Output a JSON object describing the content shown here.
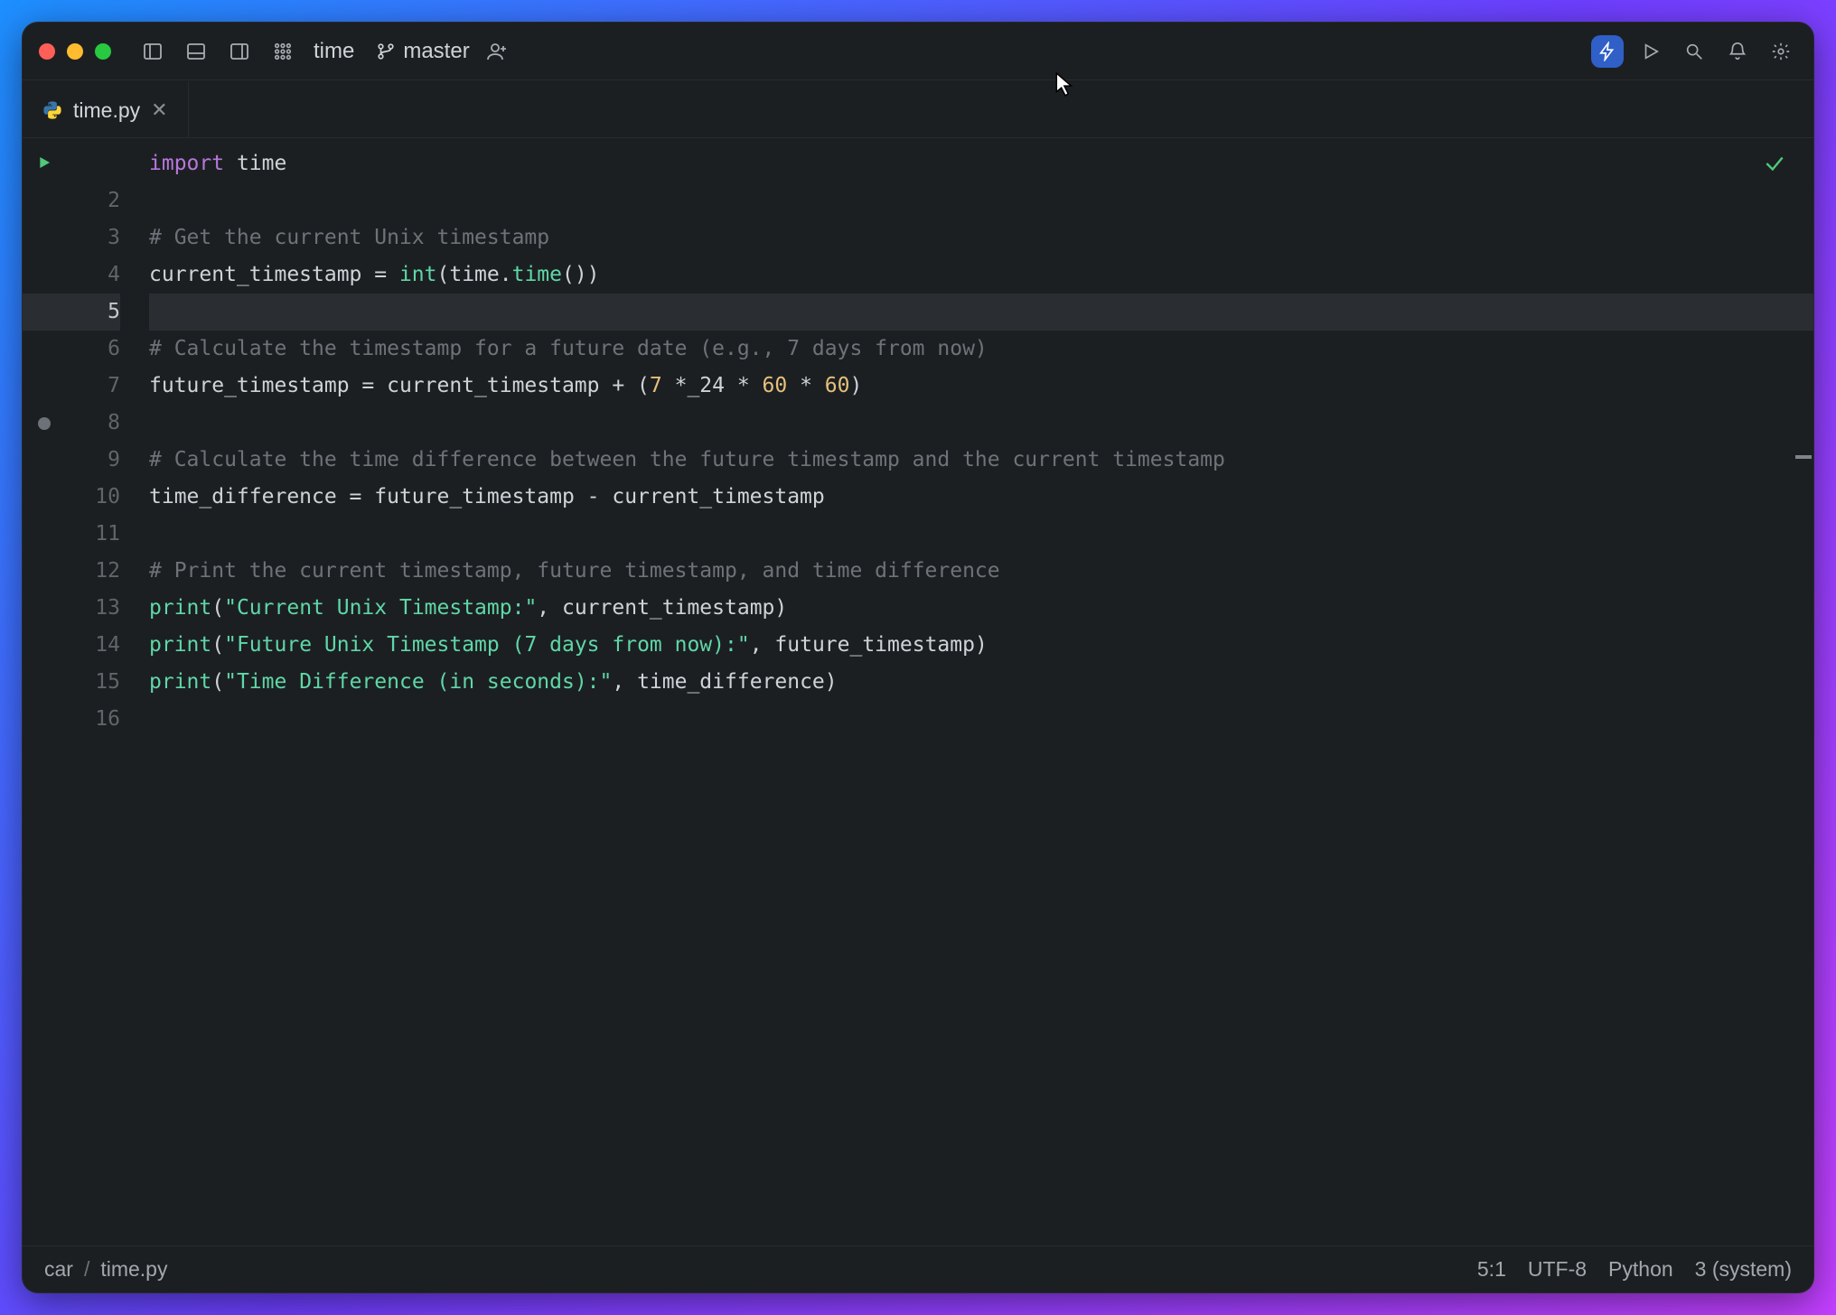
{
  "titlebar": {
    "project_name": "time",
    "branch_label": "master"
  },
  "tabs": {
    "active": {
      "filename": "time.py"
    }
  },
  "editor": {
    "filename": "time.py",
    "language": "Python",
    "current_line_index": 4,
    "breakpoint_line_index": 7,
    "lines_display": [
      "import time",
      "",
      "# Get the current Unix timestamp",
      "current_timestamp = int(time.time())",
      "",
      "# Calculate the timestamp for a future date (e.g., 7 days from now)",
      "future_timestamp = current_timestamp + (7 *_24 * 60 * 60)",
      "",
      "# Calculate the time difference between the future timestamp and the current timestamp",
      "time_difference = future_timestamp - current_timestamp",
      "",
      "# Print the current timestamp, future timestamp, and time difference",
      "print(\"Current Unix Timestamp:\", current_timestamp)",
      "print(\"Future Unix Timestamp (7 days from now):\", future_timestamp)",
      "print(\"Time Difference (in seconds):\", time_difference)",
      ""
    ]
  },
  "statusbar": {
    "project": "car",
    "path_separator": "/",
    "file": "time.py",
    "cursor_pos": "5:1",
    "encoding": "UTF-8",
    "language": "Python",
    "interpreter": "3 (system)"
  },
  "colors": {
    "bg": "#1c1f22",
    "keyword": "#b877db",
    "string": "#5fd7a7",
    "number": "#e5c07b",
    "comment": "#6e7379"
  },
  "icons": {
    "panel_left": "panel-left-icon",
    "panel_bottom": "panel-bottom-icon",
    "panel_right": "panel-right-icon",
    "grid": "grid-icon",
    "branch": "git-branch-icon",
    "add_user": "add-user-icon",
    "bolt": "bolt-icon",
    "play": "play-icon",
    "search": "search-icon",
    "bell": "bell-icon",
    "gear": "gear-icon",
    "python": "python-file-icon",
    "close": "close-icon",
    "check": "check-icon"
  }
}
